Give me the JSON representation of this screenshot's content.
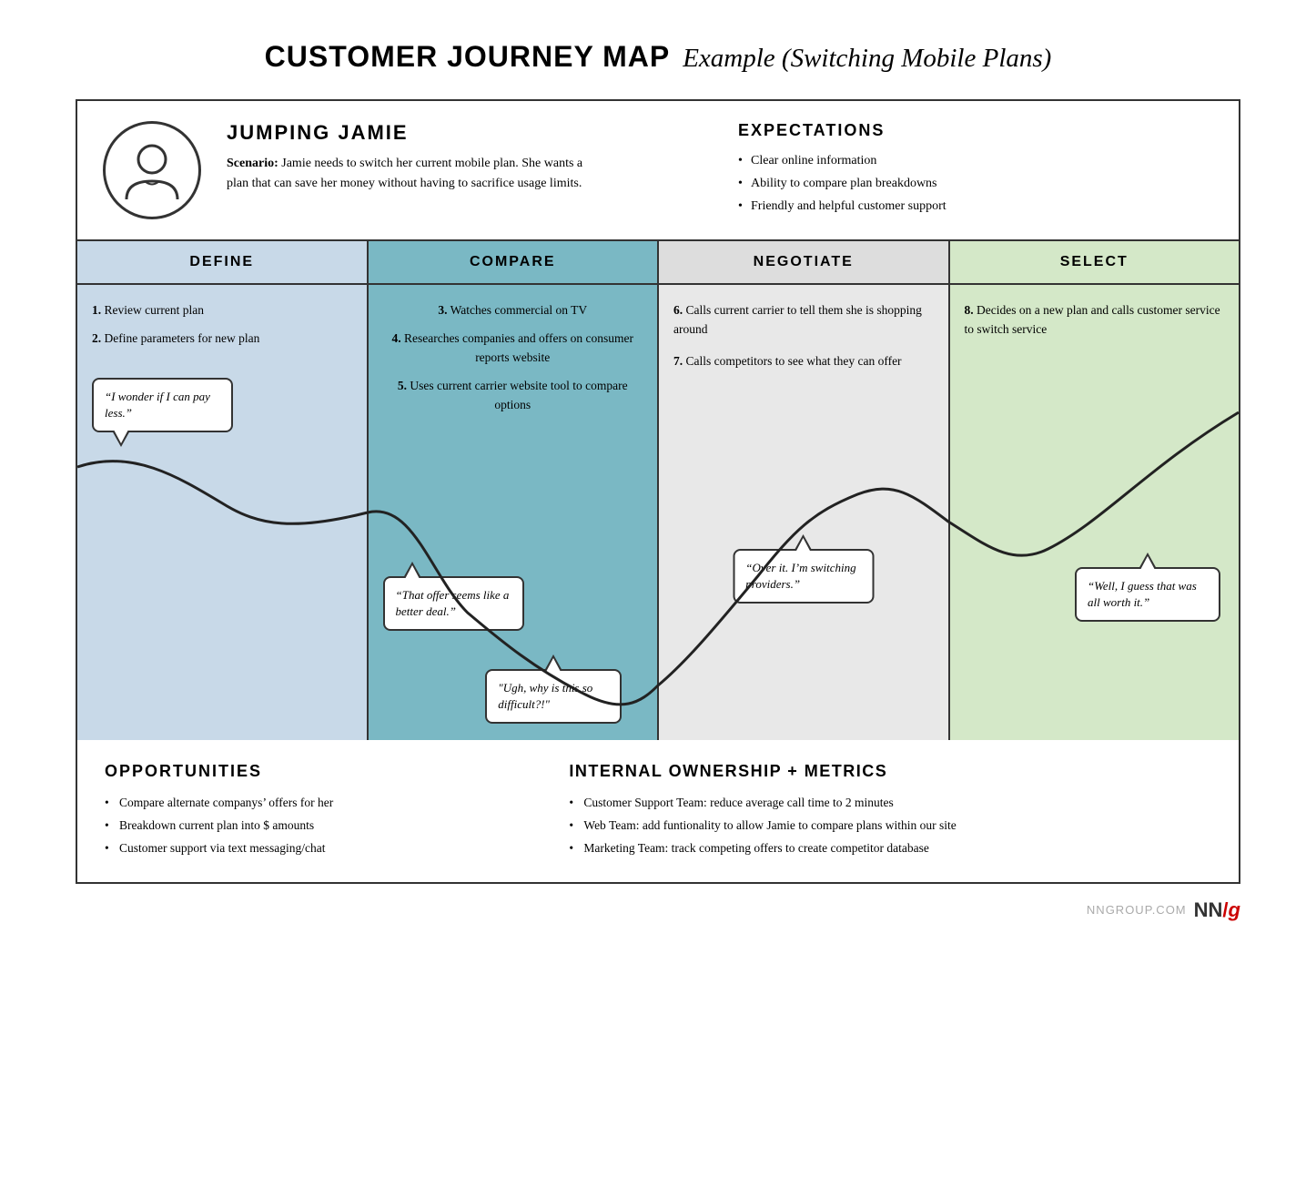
{
  "title": {
    "bold": "CUSTOMER JOURNEY MAP",
    "italic": "Example (Switching Mobile Plans)"
  },
  "persona": {
    "name": "JUMPING JAMIE",
    "scenario_label": "Scenario:",
    "scenario_text": "Jamie needs to switch her current mobile plan. She wants a plan that can save her money without having to sacrifice usage limits.",
    "avatar_label": "persona avatar"
  },
  "expectations": {
    "title": "EXPECTATIONS",
    "items": [
      "Clear online information",
      "Ability to compare plan breakdowns",
      "Friendly and helpful customer support"
    ]
  },
  "phases": [
    {
      "id": "define",
      "label": "DEFINE",
      "color_class": "phase-define",
      "steps": [
        {
          "num": "1.",
          "text": "Review current plan"
        },
        {
          "num": "2.",
          "text": "Define parameters for new plan"
        }
      ],
      "bubble": "“I wonder if I can pay less.”",
      "bubble_pos": "mid-left"
    },
    {
      "id": "compare",
      "label": "COMPARE",
      "color_class": "phase-compare",
      "steps": [
        {
          "num": "3.",
          "text": "Watches commercial on TV"
        },
        {
          "num": "4.",
          "text": "Researches companies and offers on consumer reports website"
        },
        {
          "num": "5.",
          "text": "Uses current carrier website tool to compare options"
        }
      ],
      "bubble": "“That offer seems like a better deal.”",
      "bubble_pos": "bottom-left"
    },
    {
      "id": "negotiate",
      "label": "NEGOTIATE",
      "color_class": "phase-negotiate",
      "steps": [
        {
          "num": "6.",
          "text": "Calls current carrier to tell them she is shopping around"
        },
        {
          "num": "7.",
          "text": "Calls competitors to see what they can offer"
        }
      ],
      "bubble": "“Over it. I’m switching providers.”",
      "bubble_pos": "mid"
    },
    {
      "id": "select",
      "label": "SELECT",
      "color_class": "phase-select",
      "steps": [
        {
          "num": "8.",
          "text": "Decides on a new plan and calls customer service to switch service"
        }
      ],
      "bubble": "“Well, I guess that was all worth it.”",
      "bubble_pos": "mid"
    }
  ],
  "emotion_bubbles": [
    {
      "phase": "compare_bottom",
      "text": "“Ugh, why is this so difficult?!”"
    }
  ],
  "opportunities": {
    "title": "OPPORTUNITIES",
    "items": [
      "Compare alternate companys’ offers for her",
      "Breakdown current plan into $ amounts",
      "Customer support via text messaging/chat"
    ]
  },
  "metrics": {
    "title": "INTERNAL OWNERSHIP + METRICS",
    "items": [
      "Customer Support Team: reduce average call time to 2 minutes",
      "Web Team: add funtionality to allow Jamie to compare plans within our site",
      "Marketing Team: track competing offers to create competitor database"
    ]
  },
  "footer": {
    "brand": "NNGROUP.COM",
    "logo_nn": "NN",
    "logo_slash": "/",
    "logo_g": "g"
  }
}
